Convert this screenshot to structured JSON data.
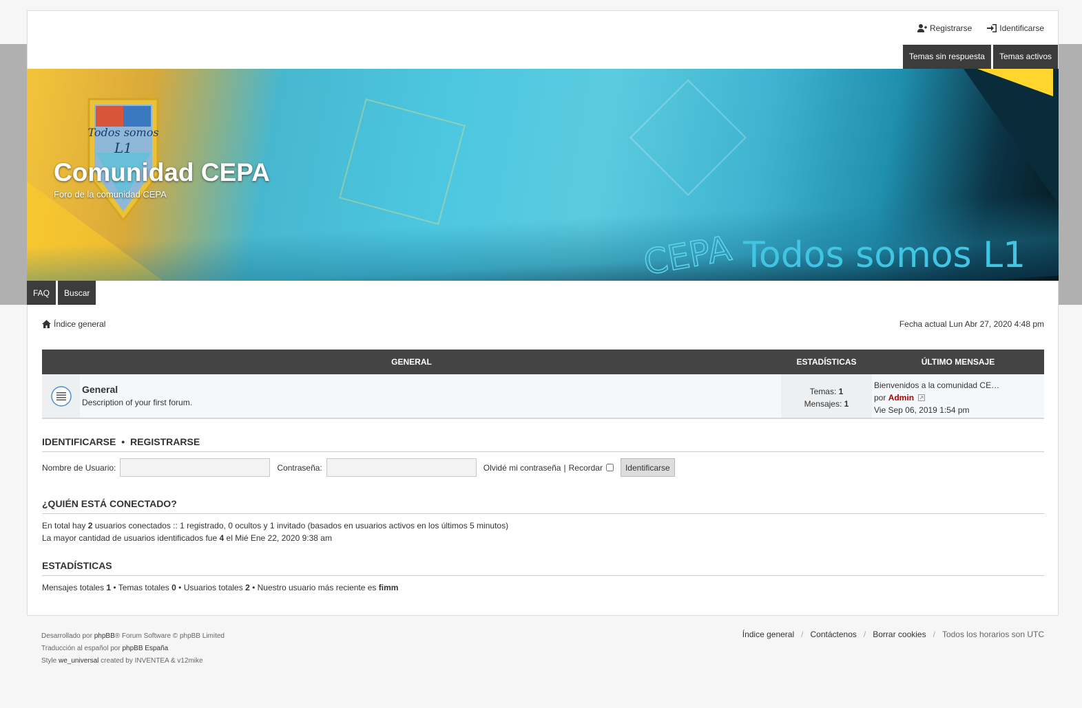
{
  "header": {
    "register_label": "Registrarse",
    "login_label": "Identificarse",
    "quick_tabs": [
      "Temas sin respuesta",
      "Temas activos"
    ]
  },
  "banner": {
    "site_title": "Comunidad CEPA",
    "site_description": "Foro de la comunidad CEPA",
    "crest_text": "Todos somos L1",
    "logo_text_left": "CEPA",
    "logo_text_right": "Todos somos L1"
  },
  "nav": {
    "tabs": [
      "FAQ",
      "Buscar"
    ],
    "breadcrumb": "Índice general",
    "current_date": "Fecha actual Lun Abr 27, 2020 4:48 pm"
  },
  "forums": {
    "head_general": "GENERAL",
    "head_stats": "ESTADÍSTICAS",
    "head_last": "ÚLTIMO MENSAJE",
    "row": {
      "name": "General",
      "description": "Description of your first forum.",
      "topics_label": "Temas:",
      "topics": "1",
      "posts_label": "Mensajes:",
      "posts": "1",
      "last_title": "Bienvenidos a la comunidad CE…",
      "last_by": "por",
      "last_author": "Admin",
      "last_date": "Vie Sep 06, 2019 1:54 pm"
    }
  },
  "login": {
    "title_login": "IDENTIFICARSE",
    "title_bullet": "•",
    "title_register": "REGISTRARSE",
    "username_label": "Nombre de Usuario:",
    "password_label": "Contraseña:",
    "forgot_label": "Olvidé mi contraseña",
    "pipe": "|",
    "remember_label": "Recordar",
    "button_label": "Identificarse"
  },
  "online": {
    "title": "¿QUIÉN ESTÁ CONECTADO?",
    "line1_a": "En total hay",
    "line1_count": "2",
    "line1_b": "usuarios conectados :: 1 registrado, 0 ocultos y 1 invitado (basados en usuarios activos en los últimos 5 minutos)",
    "line2_a": "La mayor cantidad de usuarios identificados fue",
    "line2_count": "4",
    "line2_b": "el Mié Ene 22, 2020 9:38 am"
  },
  "stats": {
    "title": "ESTADÍSTICAS",
    "posts_label": "Mensajes totales",
    "posts": "1",
    "topics_label": "• Temas totales",
    "topics": "0",
    "users_label": "• Usuarios totales",
    "users": "2",
    "newest_label": "• Nuestro usuario más reciente es",
    "newest": "fimm"
  },
  "footer": {
    "line1_a": "Desarrollado por",
    "line1_link": "phpBB",
    "line1_b": "® Forum Software © phpBB Limited",
    "line2_a": "Traducción al español por",
    "line2_link": "phpBB España",
    "line3_a": "Style",
    "line3_link": "we_universal",
    "line3_b": "created by INVENTEA & v12mike",
    "links": [
      "Índice general",
      "Contáctenos",
      "Borrar cookies"
    ],
    "divider": "/",
    "timezone": "Todos los horarios son UTC"
  },
  "colors": {
    "dark_tab": "#3c3c3c",
    "table_head": "#444444",
    "author": "#aa0000",
    "gray_band": "#b0b0b0"
  }
}
